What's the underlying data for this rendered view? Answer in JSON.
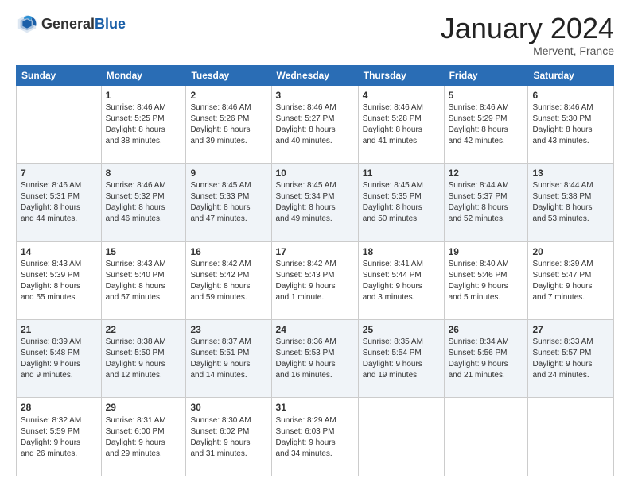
{
  "header": {
    "logo_general": "General",
    "logo_blue": "Blue",
    "month_title": "January 2024",
    "location": "Mervent, France"
  },
  "days_of_week": [
    "Sunday",
    "Monday",
    "Tuesday",
    "Wednesday",
    "Thursday",
    "Friday",
    "Saturday"
  ],
  "weeks": [
    [
      {
        "day": "",
        "sunrise": "",
        "sunset": "",
        "daylight": ""
      },
      {
        "day": "1",
        "sunrise": "Sunrise: 8:46 AM",
        "sunset": "Sunset: 5:25 PM",
        "daylight": "Daylight: 8 hours and 38 minutes."
      },
      {
        "day": "2",
        "sunrise": "Sunrise: 8:46 AM",
        "sunset": "Sunset: 5:26 PM",
        "daylight": "Daylight: 8 hours and 39 minutes."
      },
      {
        "day": "3",
        "sunrise": "Sunrise: 8:46 AM",
        "sunset": "Sunset: 5:27 PM",
        "daylight": "Daylight: 8 hours and 40 minutes."
      },
      {
        "day": "4",
        "sunrise": "Sunrise: 8:46 AM",
        "sunset": "Sunset: 5:28 PM",
        "daylight": "Daylight: 8 hours and 41 minutes."
      },
      {
        "day": "5",
        "sunrise": "Sunrise: 8:46 AM",
        "sunset": "Sunset: 5:29 PM",
        "daylight": "Daylight: 8 hours and 42 minutes."
      },
      {
        "day": "6",
        "sunrise": "Sunrise: 8:46 AM",
        "sunset": "Sunset: 5:30 PM",
        "daylight": "Daylight: 8 hours and 43 minutes."
      }
    ],
    [
      {
        "day": "7",
        "sunrise": "Sunrise: 8:46 AM",
        "sunset": "Sunset: 5:31 PM",
        "daylight": "Daylight: 8 hours and 44 minutes."
      },
      {
        "day": "8",
        "sunrise": "Sunrise: 8:46 AM",
        "sunset": "Sunset: 5:32 PM",
        "daylight": "Daylight: 8 hours and 46 minutes."
      },
      {
        "day": "9",
        "sunrise": "Sunrise: 8:45 AM",
        "sunset": "Sunset: 5:33 PM",
        "daylight": "Daylight: 8 hours and 47 minutes."
      },
      {
        "day": "10",
        "sunrise": "Sunrise: 8:45 AM",
        "sunset": "Sunset: 5:34 PM",
        "daylight": "Daylight: 8 hours and 49 minutes."
      },
      {
        "day": "11",
        "sunrise": "Sunrise: 8:45 AM",
        "sunset": "Sunset: 5:35 PM",
        "daylight": "Daylight: 8 hours and 50 minutes."
      },
      {
        "day": "12",
        "sunrise": "Sunrise: 8:44 AM",
        "sunset": "Sunset: 5:37 PM",
        "daylight": "Daylight: 8 hours and 52 minutes."
      },
      {
        "day": "13",
        "sunrise": "Sunrise: 8:44 AM",
        "sunset": "Sunset: 5:38 PM",
        "daylight": "Daylight: 8 hours and 53 minutes."
      }
    ],
    [
      {
        "day": "14",
        "sunrise": "Sunrise: 8:43 AM",
        "sunset": "Sunset: 5:39 PM",
        "daylight": "Daylight: 8 hours and 55 minutes."
      },
      {
        "day": "15",
        "sunrise": "Sunrise: 8:43 AM",
        "sunset": "Sunset: 5:40 PM",
        "daylight": "Daylight: 8 hours and 57 minutes."
      },
      {
        "day": "16",
        "sunrise": "Sunrise: 8:42 AM",
        "sunset": "Sunset: 5:42 PM",
        "daylight": "Daylight: 8 hours and 59 minutes."
      },
      {
        "day": "17",
        "sunrise": "Sunrise: 8:42 AM",
        "sunset": "Sunset: 5:43 PM",
        "daylight": "Daylight: 9 hours and 1 minute."
      },
      {
        "day": "18",
        "sunrise": "Sunrise: 8:41 AM",
        "sunset": "Sunset: 5:44 PM",
        "daylight": "Daylight: 9 hours and 3 minutes."
      },
      {
        "day": "19",
        "sunrise": "Sunrise: 8:40 AM",
        "sunset": "Sunset: 5:46 PM",
        "daylight": "Daylight: 9 hours and 5 minutes."
      },
      {
        "day": "20",
        "sunrise": "Sunrise: 8:39 AM",
        "sunset": "Sunset: 5:47 PM",
        "daylight": "Daylight: 9 hours and 7 minutes."
      }
    ],
    [
      {
        "day": "21",
        "sunrise": "Sunrise: 8:39 AM",
        "sunset": "Sunset: 5:48 PM",
        "daylight": "Daylight: 9 hours and 9 minutes."
      },
      {
        "day": "22",
        "sunrise": "Sunrise: 8:38 AM",
        "sunset": "Sunset: 5:50 PM",
        "daylight": "Daylight: 9 hours and 12 minutes."
      },
      {
        "day": "23",
        "sunrise": "Sunrise: 8:37 AM",
        "sunset": "Sunset: 5:51 PM",
        "daylight": "Daylight: 9 hours and 14 minutes."
      },
      {
        "day": "24",
        "sunrise": "Sunrise: 8:36 AM",
        "sunset": "Sunset: 5:53 PM",
        "daylight": "Daylight: 9 hours and 16 minutes."
      },
      {
        "day": "25",
        "sunrise": "Sunrise: 8:35 AM",
        "sunset": "Sunset: 5:54 PM",
        "daylight": "Daylight: 9 hours and 19 minutes."
      },
      {
        "day": "26",
        "sunrise": "Sunrise: 8:34 AM",
        "sunset": "Sunset: 5:56 PM",
        "daylight": "Daylight: 9 hours and 21 minutes."
      },
      {
        "day": "27",
        "sunrise": "Sunrise: 8:33 AM",
        "sunset": "Sunset: 5:57 PM",
        "daylight": "Daylight: 9 hours and 24 minutes."
      }
    ],
    [
      {
        "day": "28",
        "sunrise": "Sunrise: 8:32 AM",
        "sunset": "Sunset: 5:59 PM",
        "daylight": "Daylight: 9 hours and 26 minutes."
      },
      {
        "day": "29",
        "sunrise": "Sunrise: 8:31 AM",
        "sunset": "Sunset: 6:00 PM",
        "daylight": "Daylight: 9 hours and 29 minutes."
      },
      {
        "day": "30",
        "sunrise": "Sunrise: 8:30 AM",
        "sunset": "Sunset: 6:02 PM",
        "daylight": "Daylight: 9 hours and 31 minutes."
      },
      {
        "day": "31",
        "sunrise": "Sunrise: 8:29 AM",
        "sunset": "Sunset: 6:03 PM",
        "daylight": "Daylight: 9 hours and 34 minutes."
      },
      {
        "day": "",
        "sunrise": "",
        "sunset": "",
        "daylight": ""
      },
      {
        "day": "",
        "sunrise": "",
        "sunset": "",
        "daylight": ""
      },
      {
        "day": "",
        "sunrise": "",
        "sunset": "",
        "daylight": ""
      }
    ]
  ]
}
